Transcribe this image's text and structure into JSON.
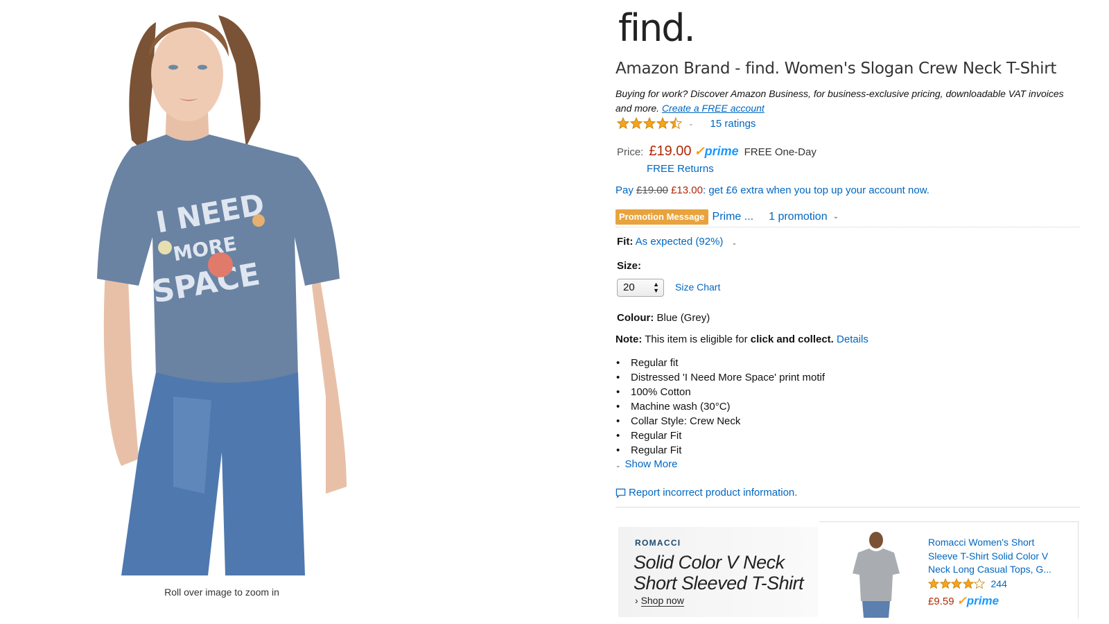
{
  "image": {
    "zoom_hint": "Roll over image to zoom in",
    "tshirt_print": [
      "I NEED",
      "MORE",
      "SPACE"
    ]
  },
  "brand_logo": "find.",
  "product_title": "Amazon Brand - find. Women's Slogan Crew Neck T-Shirt",
  "business_promo": {
    "text": "Buying for work? Discover Amazon Business, for business-exclusive pricing, downloadable VAT invoices and more.",
    "link": "Create a FREE account"
  },
  "rating": {
    "value": 4.5,
    "ratings_link": "15 ratings"
  },
  "price": {
    "label": "Price:",
    "value": "£19.00",
    "prime": "prime",
    "delivery": "FREE One-Day",
    "returns": "FREE Returns"
  },
  "topup": {
    "prefix": "Pay",
    "old_price": "£19.00",
    "new_price": "£13.00",
    "suffix": ": get £6 extra when you top up your account now."
  },
  "promotion": {
    "badge": "Promotion Message",
    "prime_text": "Prime ...",
    "count": "1 promotion"
  },
  "fit": {
    "label": "Fit:",
    "value": "As expected (92%)"
  },
  "size": {
    "label": "Size:",
    "selected": "20",
    "chart_link": "Size Chart"
  },
  "colour": {
    "label": "Colour:",
    "value": "Blue (Grey)"
  },
  "note": {
    "label": "Note:",
    "text": "This item is eligible for",
    "emphasis": "click and collect.",
    "link": "Details"
  },
  "features": [
    "Regular fit",
    "Distressed 'I Need More Space' print motif",
    "100% Cotton",
    "Machine wash (30°C)",
    "Collar Style: Crew Neck",
    "Regular Fit",
    "Regular Fit"
  ],
  "show_more": "Show More",
  "report_link": "Report incorrect product information.",
  "ad_banner": {
    "brand": "ROMACCI",
    "headline_line1": "Solid Color V Neck",
    "headline_line2": "Short Sleeved T-Shirt",
    "cta": "Shop now"
  },
  "ad_card": {
    "title": "Romacci Women's Short Sleeve T-Shirt Solid Color V Neck Long Casual Tops, G...",
    "rating": 4,
    "review_count": "244",
    "price": "£9.59",
    "prime": "prime"
  },
  "colors": {
    "link": "#0066c0",
    "price": "#B12704",
    "star": "#f4a41d",
    "promo_badge": "#e8a33d",
    "prime_blue": "#1a98ff",
    "prime_check": "#ff9900"
  }
}
